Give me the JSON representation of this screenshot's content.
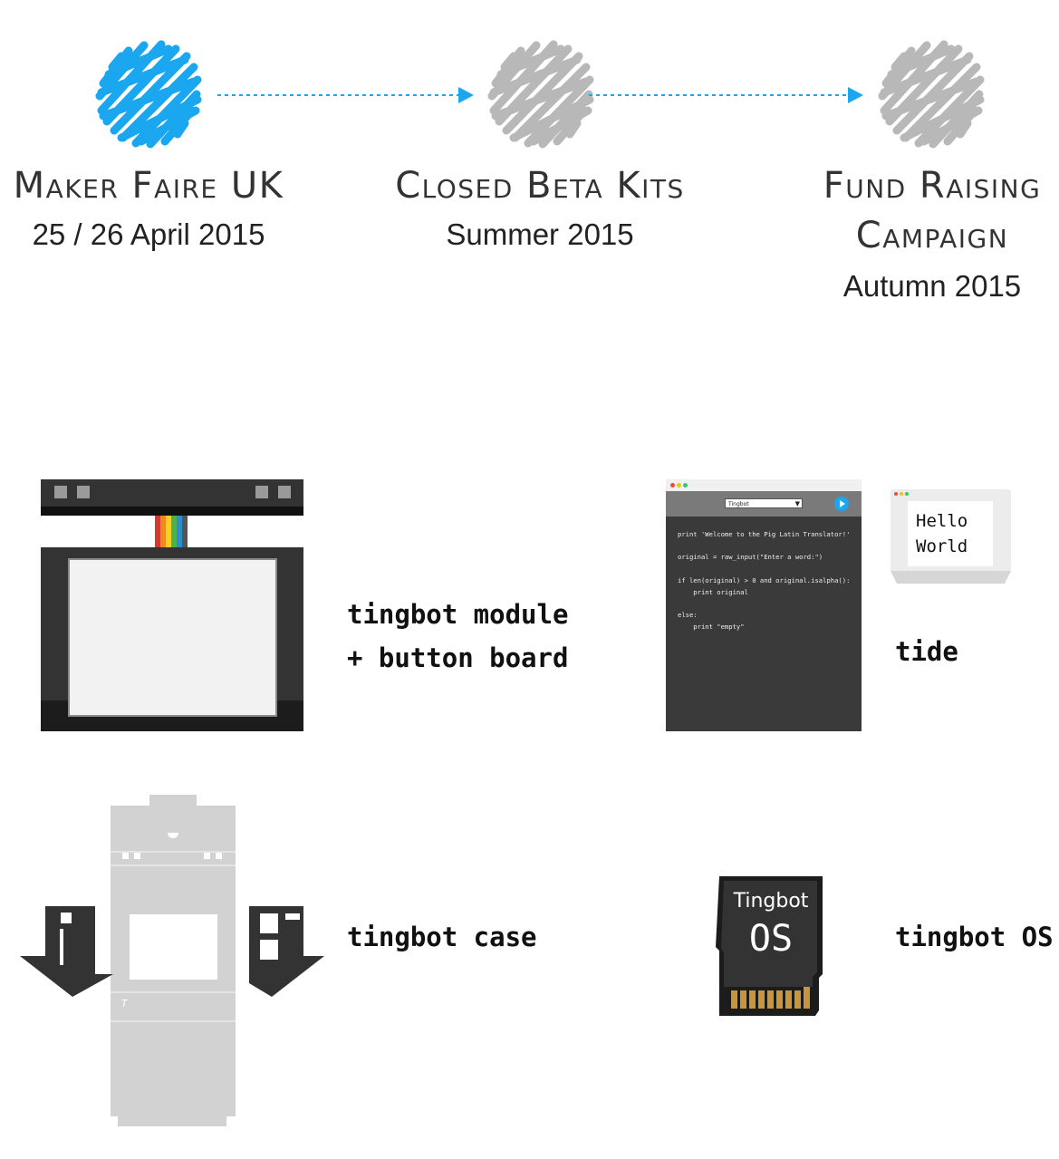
{
  "milestones": [
    {
      "title": "Maker Faire UK",
      "date": "25 / 26 April 2015",
      "color": "#1aa7f0",
      "status": "current"
    },
    {
      "title": "Closed Beta Kits",
      "date": "Summer 2015",
      "color": "#bdbdbd",
      "status": "upcoming"
    },
    {
      "title_line1": "Fund Raising",
      "title_line2": "Campaign",
      "date": "Autumn 2015",
      "color": "#bdbdbd",
      "status": "upcoming"
    }
  ],
  "arrow_color": "#1aa7f0",
  "components": {
    "module": {
      "line1": "tingbot module",
      "line2": "+ button board"
    },
    "tide": {
      "label": "tide",
      "dropdown": "Tingbot",
      "code": [
        "print 'Welcome to the Pig Latin Translator!'",
        "",
        "original = raw_input(\"Enter a word:\")",
        "",
        "if len(original) > 0 and original.isalpha():",
        "    print original",
        "",
        "else:",
        "    print \"empty\""
      ],
      "preview_line1": "Hello",
      "preview_line2": "World"
    },
    "case": {
      "label": "tingbot case"
    },
    "os": {
      "label": "tingbot OS",
      "card_line1": "Tingbot",
      "card_line2": "OS",
      "card_color": "#333333",
      "pin_color": "#c8953f"
    }
  }
}
